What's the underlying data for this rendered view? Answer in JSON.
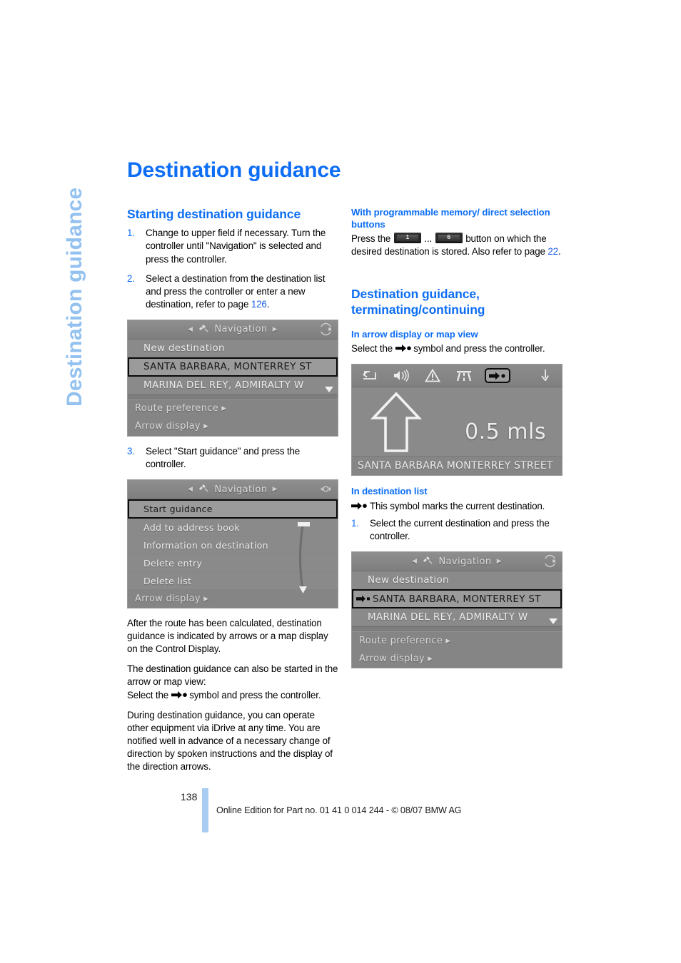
{
  "sidebar": {
    "tab_label": "Destination guidance"
  },
  "page": {
    "title": "Destination guidance",
    "number": "138",
    "footer": "Online Edition for Part no. 01 41 0 014 244 - © 08/07 BMW AG"
  },
  "colors": {
    "heading_blue": "#0d6ef5",
    "link_blue": "#1c5fe8",
    "side_tab_blue": "#93c1f0",
    "footer_bar_blue": "#a9cdf2",
    "screen_gray": "#8b8b8b"
  },
  "left_column": {
    "section_title": "Starting destination guidance",
    "steps": [
      {
        "num": "1.",
        "text": "Change to upper field if necessary. Turn the controller until \"Navigation\" is selected and press the controller."
      },
      {
        "num": "2.",
        "text_before": "Select a destination from the destination list and press the controller or enter a new destination, refer to page ",
        "link": "126",
        "text_after": "."
      }
    ],
    "step3": {
      "num": "3.",
      "text": "Select \"Start guidance\" and press the controller."
    },
    "para_after_route": "After the route has been calculated, destination guidance is indicated by arrows or a map display on the Control Display.",
    "para_also_started": "The destination guidance can also be started in the arrow or map view:",
    "para_select_symbol_before": "Select the ",
    "para_select_symbol_after": " symbol and press the controller.",
    "para_during": "During destination guidance, you can operate other equipment via iDrive at any time. You are notified well in advance of a necessary change of direction by spoken instructions and the display of the direction arrows."
  },
  "right_column": {
    "memory_heading": "With programmable memory/ direct selection buttons",
    "memory_text_1": "Press the ",
    "memory_btn_1": "1",
    "memory_ellipsis": "...",
    "memory_btn_6": "6",
    "memory_text_2": " button on which the desired destination is stored. Also refer to page ",
    "memory_page_link": "22",
    "memory_text_3": ".",
    "terminating_heading": "Destination guidance, terminating/continuing",
    "arrow_view_heading": "In arrow display or map view",
    "arrow_view_text_before": "Select the ",
    "arrow_view_text_after": " symbol and press the controller.",
    "dest_list_heading": "In destination list",
    "dest_list_symbol_text": "This symbol marks the current destination.",
    "dest_list_step": {
      "num": "1.",
      "text": "Select the current destination and press the controller."
    }
  },
  "screenshots": {
    "nav_list_1": {
      "header_title": "Navigation",
      "rows": [
        {
          "label": "New destination",
          "selected": false,
          "style": "normal"
        },
        {
          "label": "SANTA BARBARA, MONTERREY ST",
          "selected": true,
          "style": "caps"
        },
        {
          "label": "MARINA DEL REY, ADMIRALTY W",
          "selected": false,
          "style": "caps"
        }
      ],
      "footer_rows": [
        {
          "label": "Route preference ▸"
        },
        {
          "label": "Arrow display ▸"
        }
      ]
    },
    "nav_menu_2": {
      "header_title": "Navigation",
      "rows": [
        {
          "label": "Start guidance",
          "selected": true
        },
        {
          "label": "Add to address book",
          "selected": false
        },
        {
          "label": "Information on destination",
          "selected": false
        },
        {
          "label": "Delete entry",
          "selected": false
        },
        {
          "label": "Delete list",
          "selected": false
        }
      ],
      "footer_rows": [
        {
          "label": "Arrow display ▸"
        }
      ]
    },
    "arrow_display": {
      "toolbar_icons": [
        "back-arrow-icon",
        "speaker-icon",
        "warning-triangle-icon",
        "highway-icon",
        "destination-arrow-icon",
        "down-arrow-icon"
      ],
      "distance": "0.5 mls",
      "street": "SANTA BARBARA MONTERREY STREET",
      "direction": "straight-ahead-arrow"
    },
    "nav_list_3": {
      "header_title": "Navigation",
      "rows": [
        {
          "label": "New destination",
          "selected": false,
          "style": "normal",
          "marker": false
        },
        {
          "label": "SANTA BARBARA, MONTERREY ST",
          "selected": true,
          "style": "caps",
          "marker": true
        },
        {
          "label": "MARINA DEL REY, ADMIRALTY W",
          "selected": false,
          "style": "caps",
          "marker": false
        }
      ],
      "footer_rows": [
        {
          "label": "Route preference ▸"
        },
        {
          "label": "Arrow display ▸"
        }
      ]
    }
  }
}
